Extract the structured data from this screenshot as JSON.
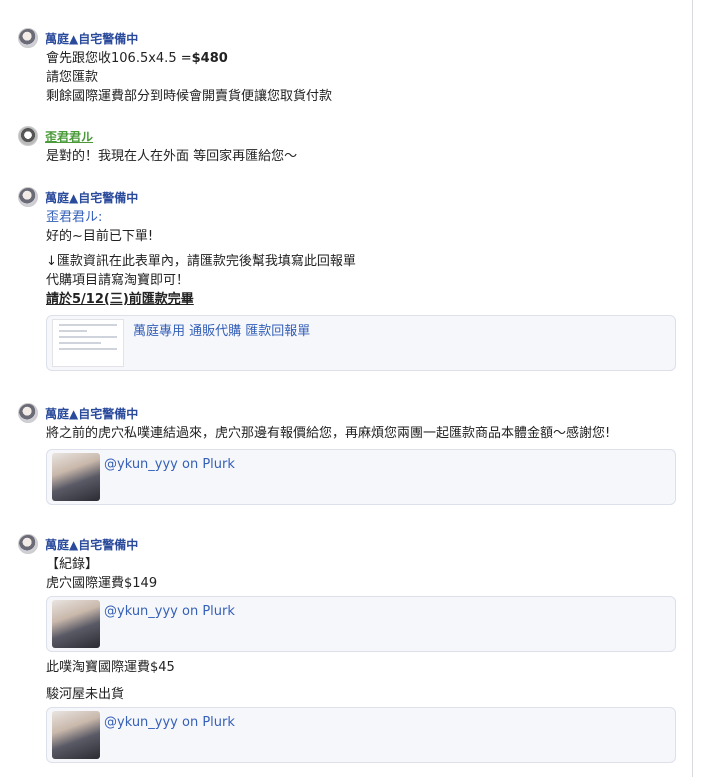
{
  "posts": [
    {
      "author": "萬庭▲自宅警備中",
      "lines": [
        "會先跟您收106.5x4.5 =",
        "$480",
        "請您匯款",
        "剩餘國際運費部分到時候會開賣貨便讓您取貨付款"
      ]
    },
    {
      "author": "歪君君ル",
      "lines": [
        "是對的！我現在人在外面 等回家再匯給您～"
      ]
    },
    {
      "author": "萬庭▲自宅警備中",
      "lines": [
        "歪君君ル:",
        "好的~目前已下單!",
        "↓匯款資訊在此表單內，請匯款完後幫我填寫此回報單",
        "代購項目請寫淘寶即可！",
        "請於5/12(三)前匯款完畢"
      ],
      "card_title": "萬庭專用 通販代購 匯款回報單"
    },
    {
      "author": "萬庭▲自宅警備中",
      "lines": [
        "將之前的虎穴私噗連結過來，虎穴那邊有報價給您，再麻煩您兩團一起匯款商品本體金額～感謝您!"
      ],
      "card_title": "@ykun_yyy on Plurk"
    },
    {
      "author": "萬庭▲自宅警備中",
      "lines": [
        "【紀錄】",
        "虎穴國際運費$149",
        "此噗淘寶國際運費$45",
        "駿河屋未出貨"
      ],
      "cards": [
        "@ykun_yyy on Plurk",
        "@ykun_yyy on Plurk"
      ]
    }
  ]
}
